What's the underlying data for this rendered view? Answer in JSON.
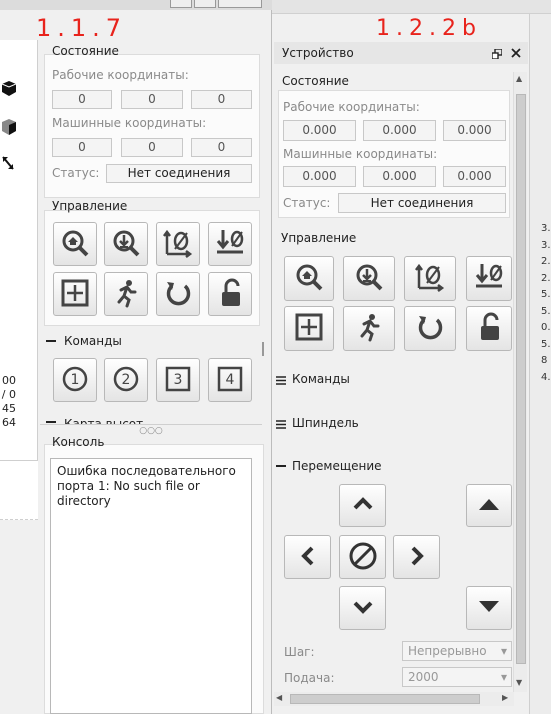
{
  "annotations": {
    "left_version": "1.1.7",
    "right_version": "1.2.2b"
  },
  "left": {
    "state_title": "Состояние",
    "work_coords_label": "Рабочие координаты:",
    "work_coords": [
      "0",
      "0",
      "0"
    ],
    "machine_coords_label": "Машинные координаты:",
    "machine_coords": [
      "0",
      "0",
      "0"
    ],
    "status_label": "Статус:",
    "status_value": "Нет соединения",
    "control_title": "Управление",
    "commands_title": "Команды",
    "command_buttons": [
      "1",
      "2",
      "3",
      "4"
    ],
    "partial_title": "Карта высот",
    "console_title": "Консоль",
    "console_text": "Ошибка последовательного порта 1: No such file or directory",
    "side_numbers": [
      "00",
      "/ 0",
      "45",
      "64"
    ]
  },
  "right": {
    "window_title": "Устройство",
    "state_title": "Состояние",
    "work_coords_label": "Рабочие координаты:",
    "work_coords": [
      "0.000",
      "0.000",
      "0.000"
    ],
    "machine_coords_label": "Машинные координаты:",
    "machine_coords": [
      "0.000",
      "0.000",
      "0.000"
    ],
    "status_label": "Статус:",
    "status_value": "Нет соединения",
    "control_title": "Управление",
    "commands_title": "Команды",
    "spindle_title": "Шпиндель",
    "movement_title": "Перемещение",
    "step_label": "Шаг:",
    "step_value": "Непрерывно",
    "feed_label": "Подача:",
    "feed_value": "2000",
    "side_numbers": [
      "3.",
      "3.",
      "2.",
      "2.",
      "5.",
      "5.",
      "0.",
      "5.",
      "8",
      "4."
    ]
  },
  "colors": {
    "annotation": "#e8231c",
    "panel": "#f0f0f0",
    "titlebar": "#e6e6e6"
  }
}
